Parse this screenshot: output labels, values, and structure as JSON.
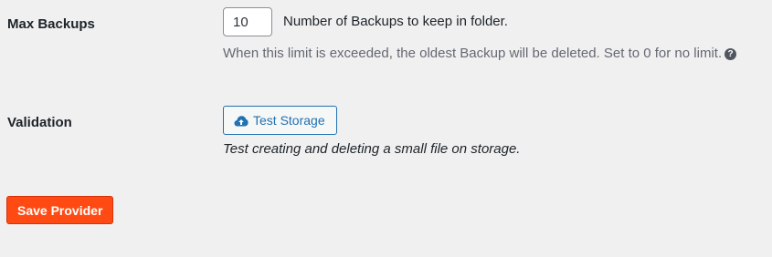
{
  "max_backups": {
    "label": "Max Backups",
    "value": "10",
    "inline_description": "Number of Backups to keep in folder.",
    "help_text": "When this limit is exceeded, the oldest Backup will be deleted. Set to 0 for no limit.",
    "help_icon": "question-circle-icon"
  },
  "validation": {
    "label": "Validation",
    "button_label": "Test Storage",
    "button_icon": "cloud-upload-icon",
    "description": "Test creating and deleting a small file on storage."
  },
  "actions": {
    "save_label": "Save Provider"
  },
  "colors": {
    "background": "#f0f0f1",
    "link_blue": "#2271b1",
    "save_orange": "#ff4b13",
    "muted_text": "#646970"
  }
}
